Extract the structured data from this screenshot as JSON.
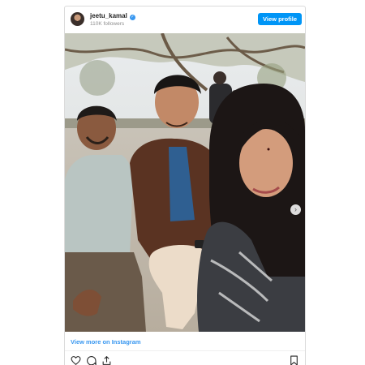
{
  "header": {
    "username": "jeetu_kamal",
    "followers": "110K followers",
    "view_profile_label": "View profile"
  },
  "post": {
    "view_more_label": "View more on Instagram",
    "carousel": {
      "count": 3,
      "active": 1
    }
  },
  "icons": {
    "verified": "verified-badge-icon",
    "like": "heart-icon",
    "comment": "comment-icon",
    "share": "share-icon",
    "save": "bookmark-icon",
    "next": "chevron-right-icon"
  },
  "colors": {
    "accent": "#0095f6",
    "link": "#3897f0",
    "text": "#262626",
    "muted": "#8e8e8e"
  }
}
